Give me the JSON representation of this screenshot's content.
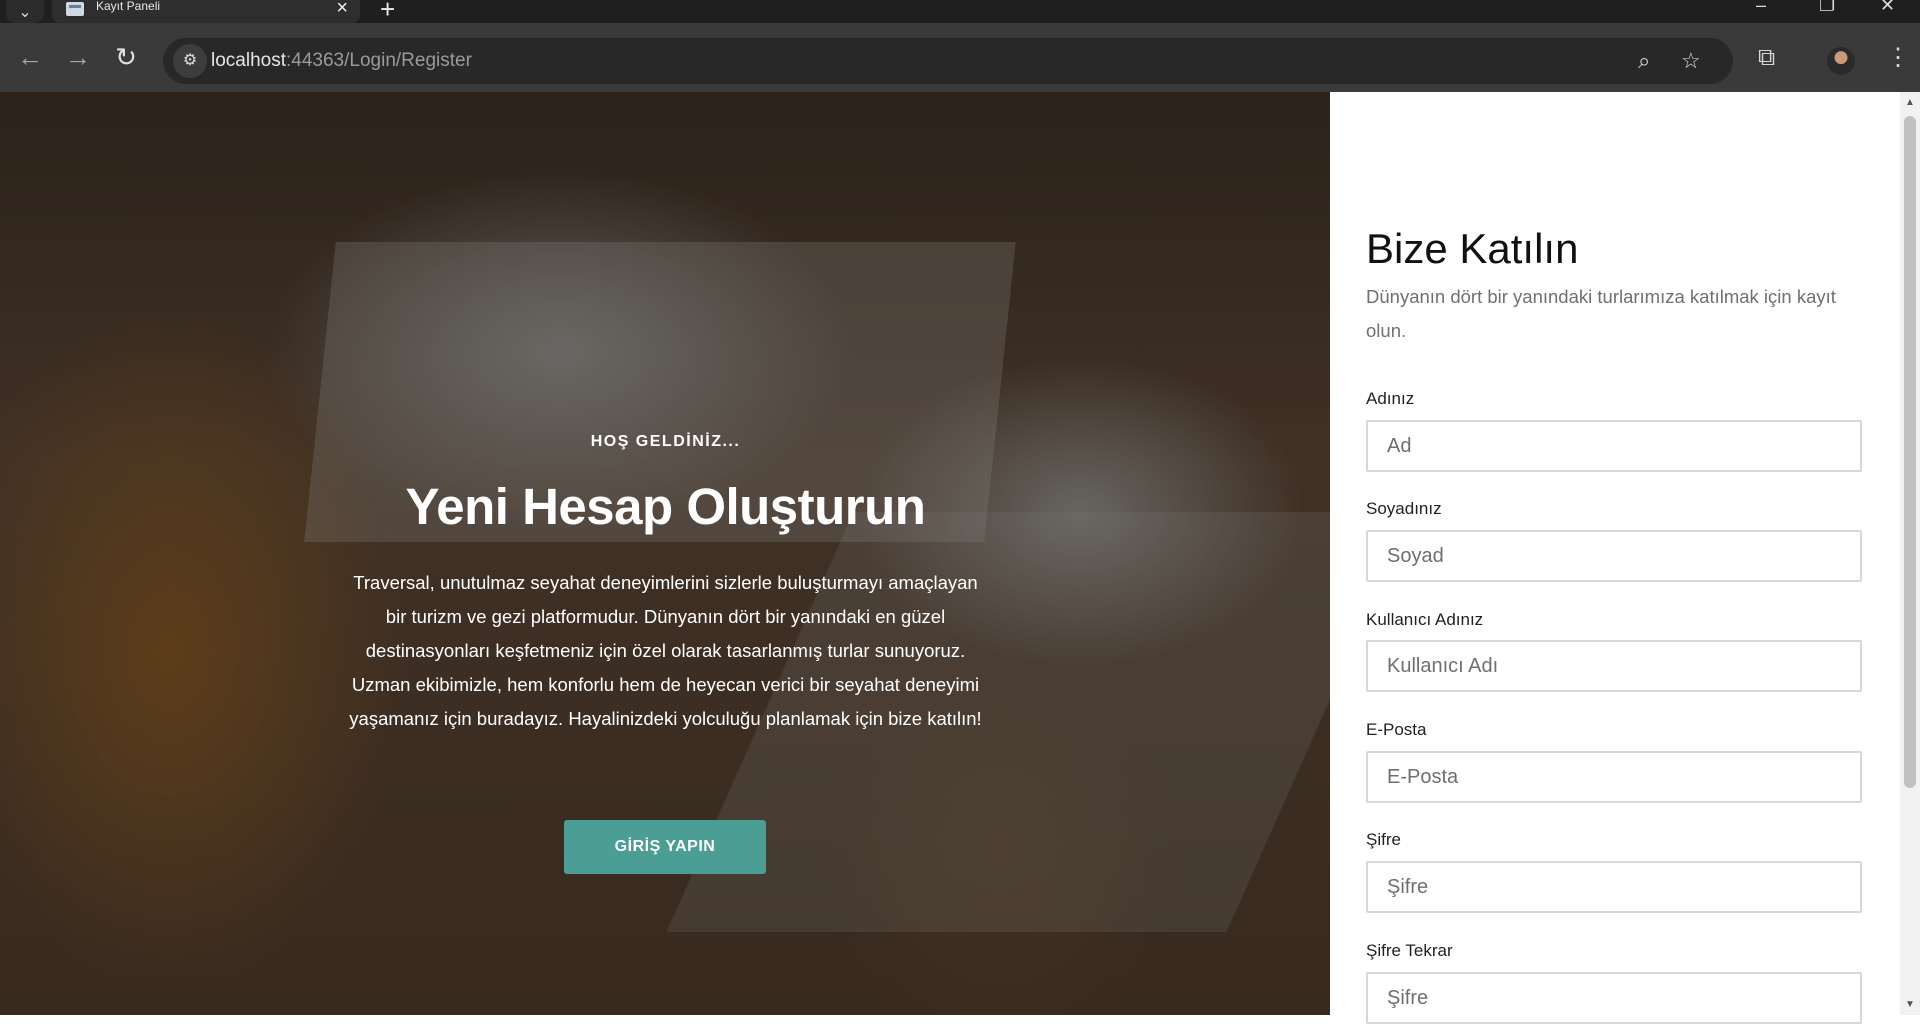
{
  "browser": {
    "tab_title": "Kayıt Paneli",
    "url_host": "localhost",
    "url_path": ":44363/Login/Register"
  },
  "hero": {
    "kicker": "HOŞ GELDİNİZ...",
    "headline": "Yeni Hesap Oluşturun",
    "description": "Traversal, unutulmaz seyahat deneyimlerini sizlerle buluşturmayı amaçlayan bir turizm ve gezi platformudur. Dünyanın dört bir yanındaki en güzel destinasyonları keşfetmeniz için özel olarak tasarlanmış turlar sunuyoruz. Uzman ekibimizle, hem konforlu hem de heyecan verici bir seyahat deneyimi yaşamanız için buradayız. Hayalinizdeki yolculuğu planlamak için bize katılın!",
    "login_button": "GİRİŞ YAPIN",
    "accent_color": "#4a9e93"
  },
  "form": {
    "title": "Bize Katılın",
    "subtitle": "Dünyanın dört bir yanındaki turlarımıza katılmak için kayıt olun.",
    "fields": [
      {
        "label": "Adınız",
        "placeholder": "Ad",
        "value": ""
      },
      {
        "label": "Soyadınız",
        "placeholder": "Soyad",
        "value": ""
      },
      {
        "label": "Kullanıcı Adınız",
        "placeholder": "Kullanıcı Adı",
        "value": ""
      },
      {
        "label": "E-Posta",
        "placeholder": "E-Posta",
        "value": ""
      },
      {
        "label": "Şifre",
        "placeholder": "Şifre",
        "value": ""
      },
      {
        "label": "Şifre Tekrar",
        "placeholder": "Şifre",
        "value": ""
      }
    ]
  },
  "icons": [
    "tab-list-icon",
    "page-favicon-icon",
    "close-icon",
    "plus-icon",
    "minimize-icon",
    "restore-icon",
    "window-close-icon",
    "back-arrow-icon",
    "forward-arrow-icon",
    "reload-icon",
    "site-info-icon",
    "zoom-icon",
    "star-icon",
    "extensions-icon",
    "profile-avatar-icon",
    "more-vert-icon"
  ]
}
